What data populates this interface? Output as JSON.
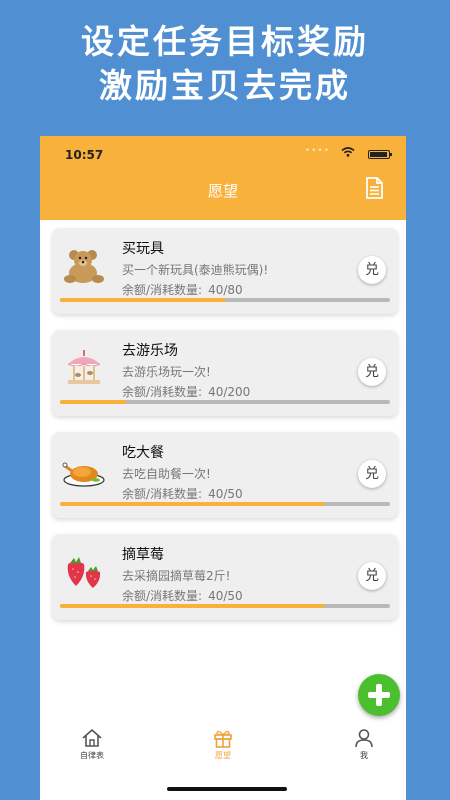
{
  "promo": {
    "line1": "设定任务目标奖励",
    "line2": "激励宝贝去完成"
  },
  "status_bar": {
    "time": "10:57"
  },
  "nav": {
    "title": "愿望",
    "right_icon": "document-icon"
  },
  "wishes": [
    {
      "title": "买玩具",
      "description": "买一个新玩具(泰迪熊玩偶)!",
      "balance_label": "余额/消耗数量:",
      "balance_value": "40/80",
      "progress": 0.5,
      "icon": "teddy-bear-icon",
      "redeem_label": "兑"
    },
    {
      "title": "去游乐场",
      "description": "去游乐场玩一次!",
      "balance_label": "余额/消耗数量:",
      "balance_value": "40/200",
      "progress": 0.2,
      "icon": "carousel-icon",
      "redeem_label": "兑"
    },
    {
      "title": "吃大餐",
      "description": "去吃自助餐一次!",
      "balance_label": "余额/消耗数量:",
      "balance_value": "40/50",
      "progress": 0.8,
      "icon": "roast-chicken-icon",
      "redeem_label": "兑"
    },
    {
      "title": "摘草莓",
      "description": "去采摘园摘草莓2斤!",
      "balance_label": "余额/消耗数量:",
      "balance_value": "40/50",
      "progress": 0.8,
      "icon": "strawberry-icon",
      "redeem_label": "兑"
    }
  ],
  "tabs": [
    {
      "label": "自律表",
      "icon": "home-icon",
      "active": false
    },
    {
      "label": "愿望",
      "icon": "gift-icon",
      "active": true
    },
    {
      "label": "我",
      "icon": "user-icon",
      "active": false
    }
  ],
  "colors": {
    "accent": "#f8b13a",
    "background": "#4f8fd2",
    "add": "#4cbf2f"
  }
}
